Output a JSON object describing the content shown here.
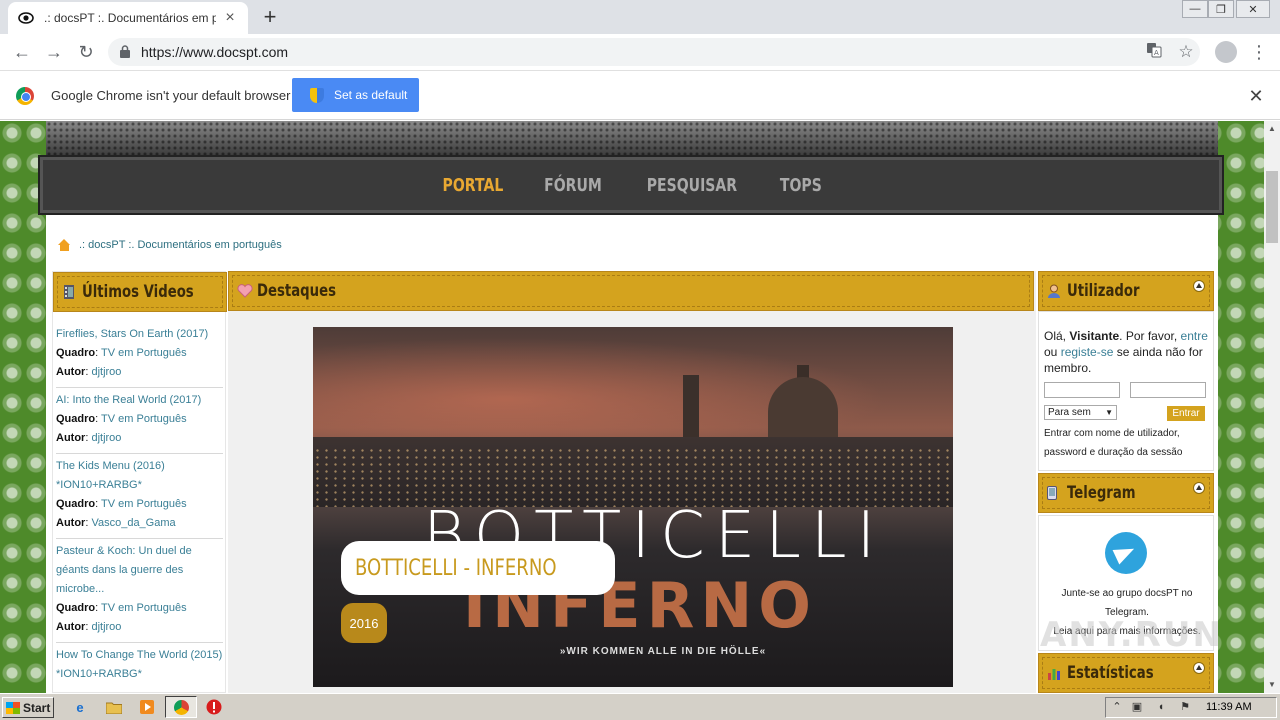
{
  "browser": {
    "tab_title": ".: docsPT :. Documentários em português",
    "url": "https://www.docspt.com",
    "infobar_text": "Google Chrome isn't your default browser",
    "set_default_label": "Set as default"
  },
  "site": {
    "nav": [
      "PORTAL",
      "FÓRUM",
      "PESQUISAR",
      "TOPS"
    ],
    "active_nav": "PORTAL",
    "breadcrumb": ".: docsPT :. Documentários em português",
    "blocks": {
      "latest_videos": "Últimos Videos",
      "highlights": "Destaques",
      "user": "Utilizador",
      "telegram": "Telegram",
      "stats": "Estatísticas"
    },
    "latest_videos": [
      {
        "title": "Fireflies, Stars On Earth (2017)",
        "quadro_label": "Quadro",
        "quadro": "TV em Português",
        "autor_label": "Autor",
        "autor": "djtjroo"
      },
      {
        "title": "AI: Into the Real World (2017)",
        "quadro_label": "Quadro",
        "quadro": "TV em Português",
        "autor_label": "Autor",
        "autor": "djtjroo"
      },
      {
        "title": "The Kids Menu (2016) *ION10+RARBG*",
        "quadro_label": "Quadro",
        "quadro": "TV em Português",
        "autor_label": "Autor",
        "autor": "Vasco_da_Gama"
      },
      {
        "title": "Pasteur & Koch: Un duel de géants dans la guerre des microbe...",
        "quadro_label": "Quadro",
        "quadro": "TV em Português",
        "autor_label": "Autor",
        "autor": "djtjroo"
      },
      {
        "title": "How To Change The World (2015) *ION10+RARBG*",
        "quadro_label": "",
        "quadro": "",
        "autor_label": "",
        "autor": ""
      }
    ],
    "featured": {
      "poster_line1": "BOTTICELLI",
      "poster_line2": "INFERNO",
      "poster_tagline": "»WIR KOMMEN ALLE IN DIE HÖLLE«",
      "caption": "BOTTICELLI - INFERNO",
      "year": "2016"
    },
    "user_box": {
      "greeting": "Olá,",
      "visitor": "Visitante",
      "please": ". Por favor,",
      "login_link": "entre",
      "or": "ou",
      "register_link": "registe-se",
      "if_not": "se ainda não for membro.",
      "duration_select": "Para sem",
      "enter_button": "Entrar",
      "hint": "Entrar com nome de utilizador, password e duração da sessão"
    },
    "telegram_box": {
      "text1": "Junte-se ao grupo docsPT no Telegram.",
      "text2": "Leia aqui para mais informações."
    },
    "watermark": "ANY.RUN"
  },
  "taskbar": {
    "start_label": "Start",
    "clock": "11:39 AM"
  },
  "colors": {
    "accent_gold": "#d4a31e",
    "nav_active": "#e8a832",
    "link_teal": "#3a7f96",
    "chrome_blue": "#4a8af4",
    "background_green": "#4e8a2a"
  }
}
